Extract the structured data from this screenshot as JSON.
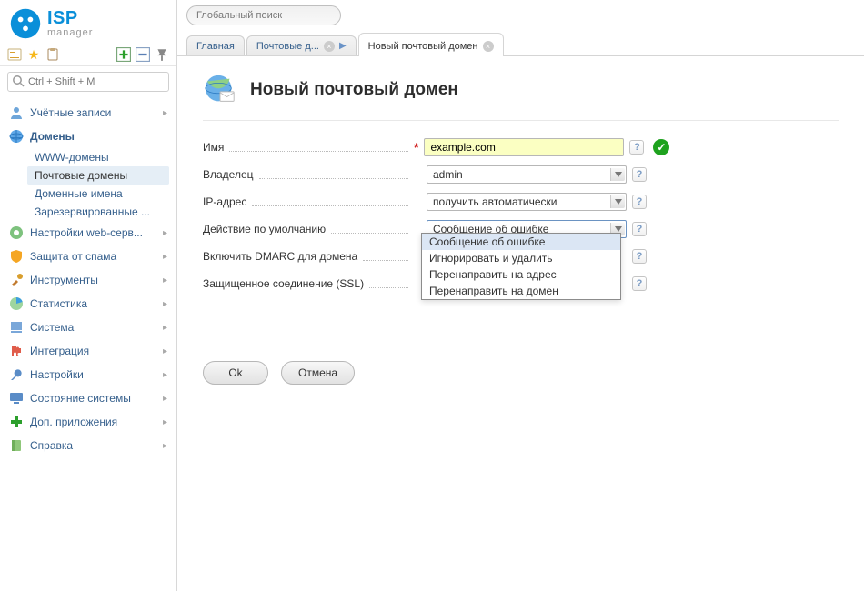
{
  "logo": {
    "isp": "ISP",
    "manager": "manager"
  },
  "global_search_placeholder": "Глобальный поиск",
  "sidebar_search_placeholder": "Ctrl + Shift + M",
  "tabs": {
    "t0": "Главная",
    "t1": "Почтовые д...",
    "t2": "Новый почтовый домен"
  },
  "nav": {
    "accounts": "Учётные записи",
    "domains": "Домены",
    "www_domains": "WWW-домены",
    "mail_domains": "Почтовые домены",
    "domain_names": "Доменные имена",
    "reserved": "Зарезервированные ...",
    "web_settings": "Настройки web-серв...",
    "antispam": "Защита от спама",
    "tools": "Инструменты",
    "statistics": "Статистика",
    "system": "Система",
    "integration": "Интеграция",
    "settings": "Настройки",
    "system_state": "Состояние системы",
    "addons": "Доп. приложения",
    "help": "Справка"
  },
  "page": {
    "title": "Новый почтовый домен"
  },
  "form": {
    "name_label": "Имя",
    "name_value": "example.com",
    "owner_label": "Владелец",
    "owner_value": "admin",
    "ip_label": "IP-адрес",
    "ip_value": "получить автоматически",
    "default_action_label": "Действие по умолчанию",
    "default_action_value": "Сообщение об ошибке",
    "dmarc_label": "Включить DMARC для домена",
    "ssl_label": "Защищенное соединение (SSL)"
  },
  "dropdown_options": {
    "o0": "Сообщение об ошибке",
    "o1": "Игнорировать и удалить",
    "o2": "Перенаправить на адрес",
    "o3": "Перенаправить на домен"
  },
  "buttons": {
    "ok": "Ok",
    "cancel": "Отмена"
  }
}
